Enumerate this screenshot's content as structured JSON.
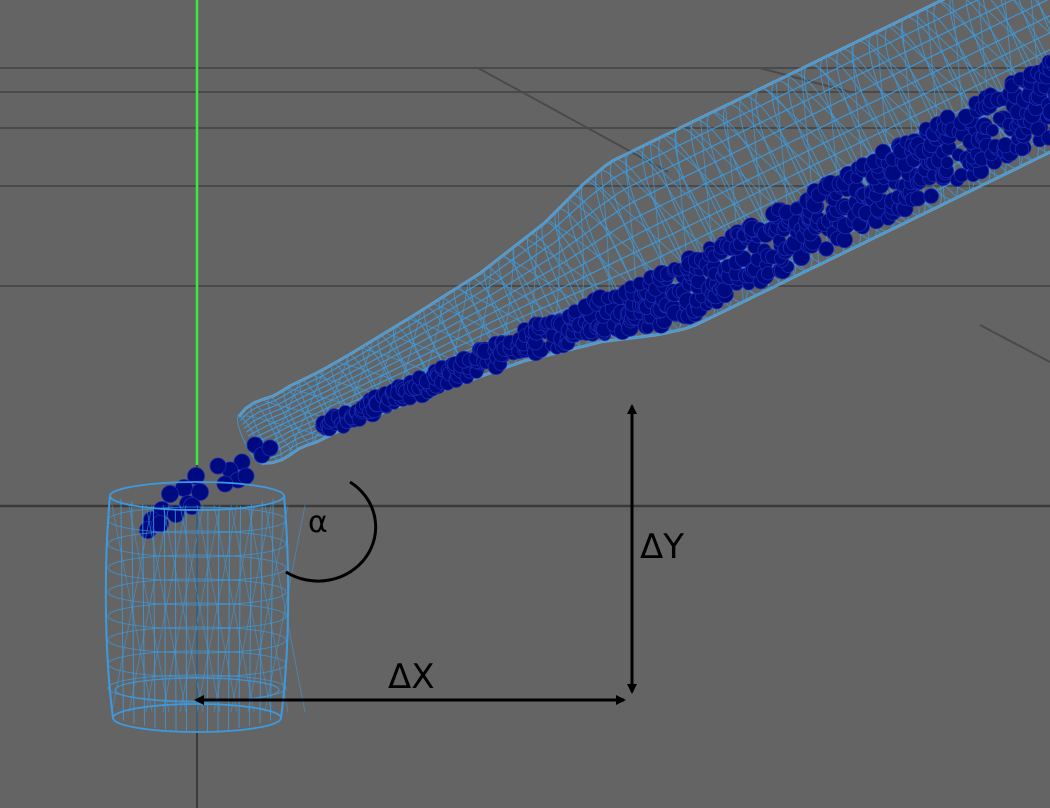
{
  "viewport": {
    "background_color": "#646464",
    "grid_color": "#4a4a4a",
    "vertical_axis_color": "#3ee83e",
    "horizontal_axis_color": "#3a3a3a"
  },
  "objects": {
    "bottle": {
      "wire_color": "#3c9be0",
      "glow_color": "#7cc8ff"
    },
    "glass": {
      "wire_color": "#3c9be0"
    },
    "liquid": {
      "particle_color": "#000a80",
      "particle_edge": "#1a2ab0"
    }
  },
  "annotations": {
    "angle_label": "α",
    "dy_label": "ΔY",
    "dx_label": "ΔX",
    "arrow_color": "#000000"
  }
}
